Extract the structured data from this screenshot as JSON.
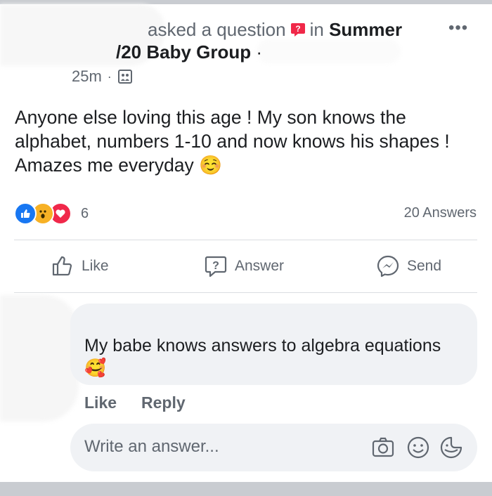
{
  "post": {
    "header": {
      "action_text": "asked a question",
      "in_text": "in",
      "group_name_line1": "Summer",
      "group_name_line2": "/20 Baby Group",
      "separator": "·",
      "more_label": "•••"
    },
    "meta": {
      "time": "25m",
      "separator": "·"
    },
    "body": "Anyone else loving this age ! My son knows the alphabet, numbers 1-10 and now knows his shapes ! Amazes me everyday ☺️",
    "reactions": {
      "count": "6",
      "types": [
        "like-icon",
        "wow-icon",
        "love-icon"
      ]
    },
    "answers_count": "20 Answers"
  },
  "actions": {
    "like": "Like",
    "answer": "Answer",
    "send": "Send"
  },
  "comment": {
    "text": "My babe knows answers to algebra equations 🥰",
    "like": "Like",
    "reply": "Reply"
  },
  "composer": {
    "placeholder": "Write an answer..."
  },
  "colors": {
    "accent": "#1877f2",
    "question_icon": "#f02849",
    "bubble": "#f0f2f5",
    "muted": "#606770"
  }
}
